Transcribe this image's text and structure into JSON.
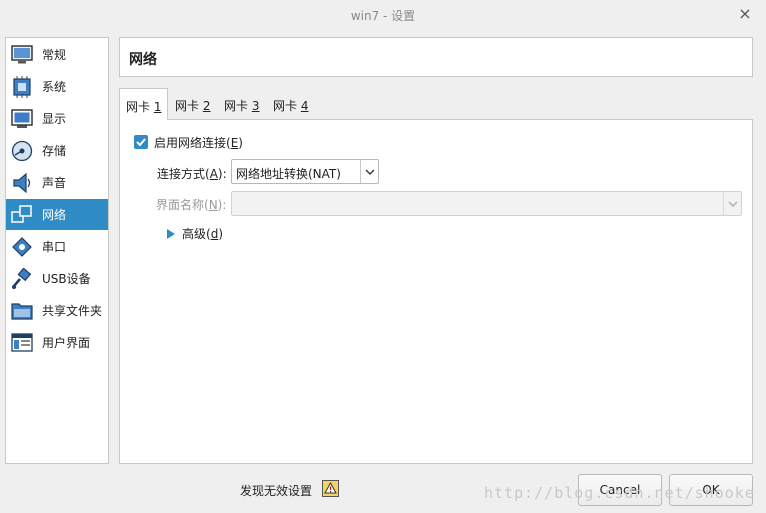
{
  "window": {
    "title": "win7 - 设置",
    "close_glyph": "×"
  },
  "sidebar": {
    "items": [
      {
        "label": "常规",
        "icon": "general-icon"
      },
      {
        "label": "系统",
        "icon": "system-chip-icon"
      },
      {
        "label": "显示",
        "icon": "display-monitor-icon"
      },
      {
        "label": "存储",
        "icon": "storage-disk-icon"
      },
      {
        "label": "声音",
        "icon": "speaker-icon"
      },
      {
        "label": "网络",
        "icon": "network-icon",
        "selected": true
      },
      {
        "label": "串口",
        "icon": "serial-port-icon"
      },
      {
        "label": "USB设备",
        "icon": "usb-icon"
      },
      {
        "label": "共享文件夹",
        "icon": "shared-folder-icon"
      },
      {
        "label": "用户界面",
        "icon": "user-interface-icon"
      }
    ]
  },
  "header": {
    "title": "网络"
  },
  "tabs": [
    {
      "label": "网卡",
      "num": "1",
      "active": true
    },
    {
      "label": "网卡",
      "num": "2"
    },
    {
      "label": "网卡",
      "num": "3"
    },
    {
      "label": "网卡",
      "num": "4"
    }
  ],
  "adapter": {
    "enable_label": "启用网络连接(",
    "enable_key": "E",
    "enable_end": ")",
    "enabled": true,
    "attach_label": "连接方式(",
    "attach_key": "A",
    "attach_end": "):",
    "attach_value": "网络地址转换(NAT)",
    "name_label": "界面名称(",
    "name_key": "N",
    "name_end": "):",
    "name_value": "",
    "advanced_label": "高级(",
    "advanced_key": "d",
    "advanced_end": ")"
  },
  "footer": {
    "invalid_settings": "发现无效设置",
    "cancel": "Cancel",
    "ok": "OK",
    "watermark": "http://blog.csdn.net/shooke"
  },
  "colors": {
    "accent": "#308cc6",
    "background": "#efefef",
    "panel": "#ffffff"
  }
}
